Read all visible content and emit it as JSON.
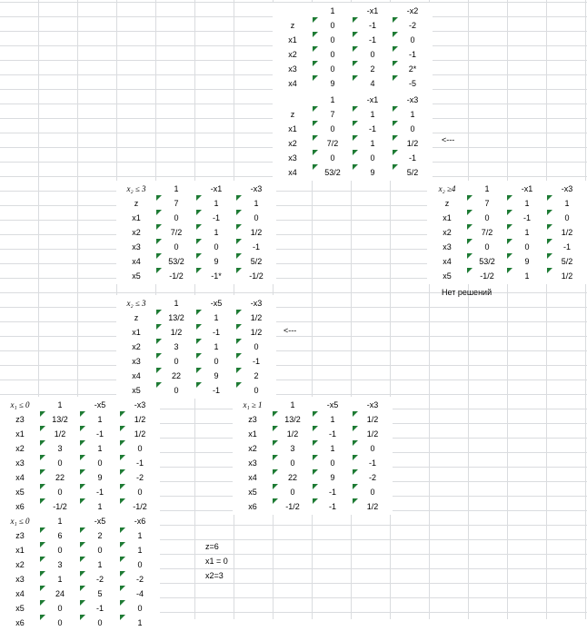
{
  "tables": [
    {
      "id": "t1",
      "label": "",
      "header": [
        "1",
        "-x1",
        "-x2"
      ],
      "rows": [
        {
          "var": "z",
          "vals": [
            "0",
            "-1",
            "-2"
          ]
        },
        {
          "var": "x1",
          "vals": [
            "0",
            "-1",
            "0"
          ]
        },
        {
          "var": "x2",
          "vals": [
            "0",
            "0",
            "-1"
          ]
        },
        {
          "var": "x3",
          "vals": [
            "0",
            "2",
            "2*"
          ]
        },
        {
          "var": "x4",
          "vals": [
            "9",
            "4",
            "-5"
          ]
        }
      ]
    },
    {
      "id": "t2",
      "label": "",
      "header": [
        "1",
        "-x1",
        "-x3"
      ],
      "rows": [
        {
          "var": "z",
          "vals": [
            "7",
            "1",
            "1"
          ]
        },
        {
          "var": "x1",
          "vals": [
            "0",
            "-1",
            "0"
          ]
        },
        {
          "var": "x2",
          "vals": [
            "7/2",
            "1",
            "1/2"
          ]
        },
        {
          "var": "x3",
          "vals": [
            "0",
            "0",
            "-1"
          ]
        },
        {
          "var": "x4",
          "vals": [
            "53/2",
            "9",
            "5/2"
          ]
        }
      ]
    },
    {
      "id": "t3",
      "label": "x₂ ≤ 3",
      "header": [
        "1",
        "-x1",
        "-x3"
      ],
      "rows": [
        {
          "var": "z",
          "vals": [
            "7",
            "1",
            "1"
          ]
        },
        {
          "var": "x1",
          "vals": [
            "0",
            "-1",
            "0"
          ]
        },
        {
          "var": "x2",
          "vals": [
            "7/2",
            "1",
            "1/2"
          ]
        },
        {
          "var": "x3",
          "vals": [
            "0",
            "0",
            "-1"
          ]
        },
        {
          "var": "x4",
          "vals": [
            "53/2",
            "9",
            "5/2"
          ]
        },
        {
          "var": "x5",
          "vals": [
            "-1/2",
            "-1*",
            "-1/2"
          ]
        }
      ]
    },
    {
      "id": "t4",
      "label": "x₂ ≥4",
      "header": [
        "1",
        "-x1",
        "-x3"
      ],
      "rows": [
        {
          "var": "z",
          "vals": [
            "7",
            "1",
            "1"
          ]
        },
        {
          "var": "x1",
          "vals": [
            "0",
            "-1",
            "0"
          ]
        },
        {
          "var": "x2",
          "vals": [
            "7/2",
            "1",
            "1/2"
          ]
        },
        {
          "var": "x3",
          "vals": [
            "0",
            "0",
            "-1"
          ]
        },
        {
          "var": "x4",
          "vals": [
            "53/2",
            "9",
            "5/2"
          ]
        },
        {
          "var": "x5",
          "vals": [
            "-1/2",
            "1",
            "1/2"
          ]
        }
      ]
    },
    {
      "id": "t5",
      "label": "x₂ ≤ 3",
      "header": [
        "1",
        "-x5",
        "-x3"
      ],
      "rows": [
        {
          "var": "z",
          "vals": [
            "13/2",
            "1",
            "1/2"
          ]
        },
        {
          "var": "x1",
          "vals": [
            "1/2",
            "-1",
            "1/2"
          ]
        },
        {
          "var": "x2",
          "vals": [
            "3",
            "1",
            "0"
          ]
        },
        {
          "var": "x3",
          "vals": [
            "0",
            "0",
            "-1"
          ]
        },
        {
          "var": "x4",
          "vals": [
            "22",
            "9",
            "2"
          ]
        },
        {
          "var": "x5",
          "vals": [
            "0",
            "-1",
            "0"
          ]
        }
      ]
    },
    {
      "id": "t6",
      "label": "x₁ ≤ 0",
      "header": [
        "1",
        "-x5",
        "-x3"
      ],
      "rows": [
        {
          "var": "z3",
          "vals": [
            "13/2",
            "1",
            "1/2"
          ]
        },
        {
          "var": "x1",
          "vals": [
            "1/2",
            "-1",
            "1/2"
          ]
        },
        {
          "var": "x2",
          "vals": [
            "3",
            "1",
            "0"
          ]
        },
        {
          "var": "x3",
          "vals": [
            "0",
            "0",
            "-1"
          ]
        },
        {
          "var": "x4",
          "vals": [
            "22",
            "9",
            "-2"
          ]
        },
        {
          "var": "x5",
          "vals": [
            "0",
            "-1",
            "0"
          ]
        },
        {
          "var": "x6",
          "vals": [
            "-1/2",
            "1",
            "-1/2"
          ]
        }
      ]
    },
    {
      "id": "t7",
      "label": "x₁ ≥ 1",
      "header": [
        "1",
        "-x5",
        "-x3"
      ],
      "rows": [
        {
          "var": "z3",
          "vals": [
            "13/2",
            "1",
            "1/2"
          ]
        },
        {
          "var": "x1",
          "vals": [
            "1/2",
            "-1",
            "1/2"
          ]
        },
        {
          "var": "x2",
          "vals": [
            "3",
            "1",
            "0"
          ]
        },
        {
          "var": "x3",
          "vals": [
            "0",
            "0",
            "-1"
          ]
        },
        {
          "var": "x4",
          "vals": [
            "22",
            "9",
            "-2"
          ]
        },
        {
          "var": "x5",
          "vals": [
            "0",
            "-1",
            "0"
          ]
        },
        {
          "var": "x6",
          "vals": [
            "-1/2",
            "-1",
            "1/2"
          ]
        }
      ]
    },
    {
      "id": "t8",
      "label": "x₁ ≤ 0",
      "header": [
        "1",
        "-x5",
        "-x6"
      ],
      "rows": [
        {
          "var": "z3",
          "vals": [
            "6",
            "2",
            "1"
          ]
        },
        {
          "var": "x1",
          "vals": [
            "0",
            "0",
            "1"
          ]
        },
        {
          "var": "x2",
          "vals": [
            "3",
            "1",
            "0"
          ]
        },
        {
          "var": "x3",
          "vals": [
            "1",
            "-2",
            "-2"
          ]
        },
        {
          "var": "x4",
          "vals": [
            "24",
            "5",
            "-4"
          ]
        },
        {
          "var": "x5",
          "vals": [
            "0",
            "-1",
            "0"
          ]
        },
        {
          "var": "x6",
          "vals": [
            "0",
            "0",
            "1"
          ]
        }
      ]
    }
  ],
  "notes": {
    "arrow1": "<---",
    "arrow2": "<---",
    "no_solution": "Нет решений",
    "result_z": "z=6",
    "result_x1": "x1 = 0",
    "result_x2": "x2=3"
  }
}
